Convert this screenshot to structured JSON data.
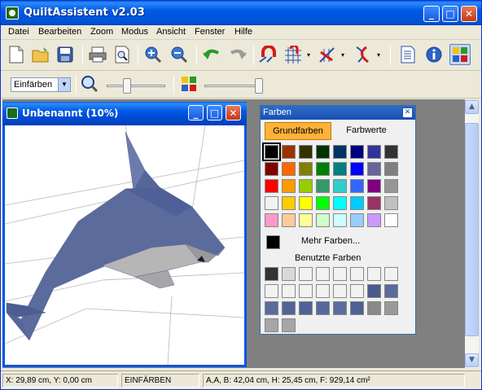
{
  "app": {
    "title": "QuiltAssistent v2.03"
  },
  "window_buttons": {
    "minimize": "_",
    "maximize": "□",
    "close": "✕"
  },
  "menu": [
    "Datei",
    "Bearbeiten",
    "Zoom",
    "Modus",
    "Ansicht",
    "Fenster",
    "Hilfe"
  ],
  "toolbar": {
    "icons": [
      "new-file-icon",
      "open-folder-icon",
      "save-disk-icon",
      "print-icon",
      "print-preview-icon",
      "zoom-in-icon",
      "zoom-out-icon",
      "undo-icon",
      "redo-icon",
      "magnet-icon",
      "grid-snap-icon",
      "line-tool-icon",
      "curve-tool-icon",
      "properties-list-icon",
      "info-icon",
      "color-palette-icon"
    ],
    "mode_select": "Einfärben"
  },
  "child_window": {
    "title": "Unbenannt (10%)"
  },
  "palette": {
    "title": "Farben",
    "tabs": [
      "Grundfarben",
      "Farbwerte"
    ],
    "active_tab": "Grundfarben",
    "more_colors": "Mehr Farben...",
    "used_colors_label": "Benutzte Farben",
    "current_color": "#000000",
    "grid": [
      [
        "#000000",
        "#993300",
        "#333300",
        "#003300",
        "#003366",
        "#000080",
        "#333399",
        "#333333"
      ],
      [
        "#800000",
        "#ff6600",
        "#808000",
        "#008000",
        "#008080",
        "#0000ff",
        "#666699",
        "#808080"
      ],
      [
        "#ff0000",
        "#ff9900",
        "#99cc00",
        "#339966",
        "#33cccc",
        "#3366ff",
        "#800080",
        "#969696"
      ],
      [
        "#f2f2f2",
        "#ffcc00",
        "#ffff00",
        "#00ff00",
        "#00ffff",
        "#00ccff",
        "#993366",
        "#c0c0c0"
      ],
      [
        "#ff99cc",
        "#ffcc99",
        "#ffff99",
        "#ccffcc",
        "#ccffff",
        "#99ccff",
        "#cc99ff",
        "#ffffff"
      ]
    ],
    "used": [
      [
        "#333333",
        "#d9d9d9",
        "#f2f2f2",
        "#f2f2f2",
        "#f2f2f2",
        "#f2f2f2",
        "#f2f2f2",
        "#f2f2f2"
      ],
      [
        "#f2f2f2",
        "#f2f2f2",
        "#f2f2f2",
        "#f2f2f2",
        "#f2f2f2",
        "#f2f2f2",
        "#4a5c8c",
        "#5a6b9c"
      ],
      [
        "#5a6b9c",
        "#52639a",
        "#4f6198",
        "#56679d",
        "#5b6c9e",
        "#4d5f94",
        "#8a8a8a",
        "#9a9a9a"
      ],
      [
        "#a6a6a6",
        "#a6a6a6"
      ]
    ]
  },
  "status": {
    "coords": "X: 29,89 cm, Y: 0,00 cm",
    "mode": "EINFÄRBEN",
    "info": "A,A, B: 42,04 cm, H: 25,45 cm, F: 929,14 cm²"
  },
  "colors": {
    "accent": "#0058e6",
    "dolphin": "#5b6b9c",
    "dolphin_belly": "#b6b6b6",
    "palette_tab": "#ffb13a"
  }
}
